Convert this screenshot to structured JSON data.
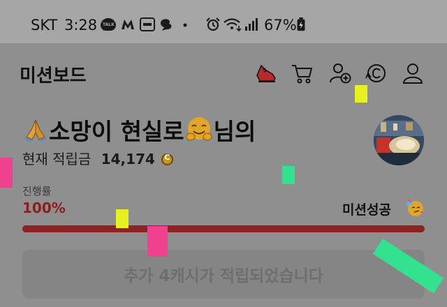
{
  "status_bar": {
    "carrier": "SKT",
    "time": "3:28",
    "talk_icon_text": "TALK",
    "battery_percent": "67%",
    "icons": [
      "chat-icon",
      "talk-icon",
      "m-app-icon",
      "notice-app-icon",
      "cloud-app-icon",
      "dot-icon",
      "alarm-icon",
      "wifi-icon",
      "signal-icon",
      "battery-icon"
    ]
  },
  "header": {
    "title": "미션보드",
    "icons": [
      "shoe-icon",
      "cart-icon",
      "add-friend-icon",
      "coin-history-icon",
      "profile-icon"
    ]
  },
  "user": {
    "name": "소망이 현실로",
    "suffix": "님의",
    "balance_label": "현재 적립금",
    "balance_value": "14,174"
  },
  "progress": {
    "label": "진행률",
    "value_text": "100%",
    "value": 100,
    "status": "미션성공"
  },
  "reward_button": {
    "label": "추가 4캐시가 적립되었습니다"
  },
  "colors": {
    "status_bar_bg": "#a6a6a6",
    "overlay_bg": "#8f8f8f",
    "progress_red": "#8e1d1d",
    "coin_gold": "#c8961a",
    "confetti_yellow": "#e7f020",
    "confetti_pink": "#f0418e",
    "confetti_green": "#33e28f"
  }
}
